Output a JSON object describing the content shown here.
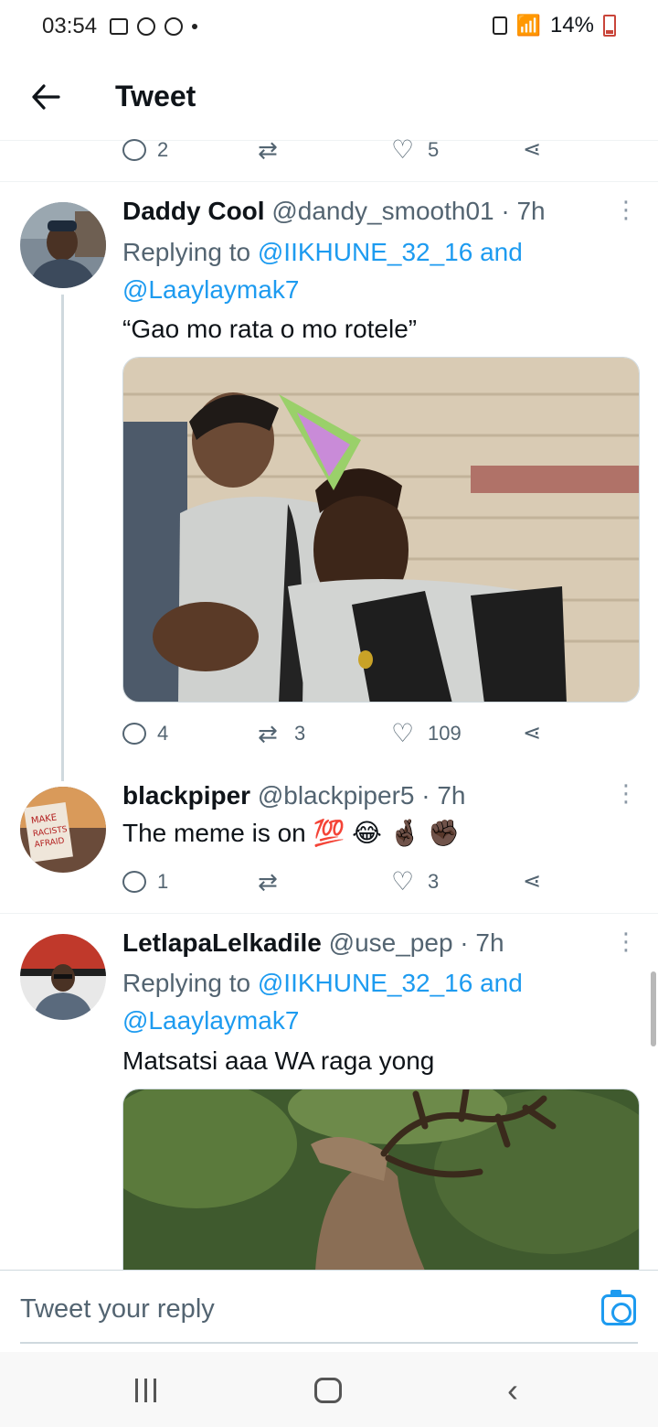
{
  "status_bar": {
    "time": "03:54",
    "battery": "14%"
  },
  "header": {
    "title": "Tweet"
  },
  "top_actions": {
    "replies": "2",
    "retweets": "",
    "likes": "5"
  },
  "tweets": [
    {
      "name": "Daddy Cool",
      "handle": "@dandy_smooth01",
      "sep": "·",
      "time": "7h",
      "replying_prefix": "Replying to",
      "replying_mention1": "@IIKHUNE_32_16",
      "replying_and": "and",
      "replying_mention2": "@Laaylaymak7",
      "text": "“Gao mo rata o mo rotele”",
      "replies": "4",
      "retweets": "3",
      "likes": "109"
    },
    {
      "name": "blackpiper",
      "handle": "@blackpiper5",
      "sep": "·",
      "time": "7h",
      "text": "The meme is on 💯 😂 🤞🏿 ✊🏿",
      "replies": "1",
      "retweets": "",
      "likes": "3"
    },
    {
      "name": "LetlapaLelkadile",
      "handle": "@use_pep",
      "sep": "·",
      "time": "7h",
      "replying_prefix": "Replying to",
      "replying_mention1": "@IIKHUNE_32_16",
      "replying_and": "and",
      "replying_mention2": "@Laaylaymak7",
      "text": "Matsatsi aaa WA raga yong"
    }
  ],
  "reply_bar": {
    "placeholder": "Tweet your reply"
  },
  "icons": {
    "back": "arrow-left-icon",
    "reply": "comment-icon",
    "retweet": "retweet-icon",
    "like": "heart-icon",
    "share": "share-icon",
    "more": "more-vertical-icon",
    "camera": "camera-icon"
  },
  "colors": {
    "accent": "#1d9bf0",
    "text": "#0f1419",
    "muted": "#536471"
  }
}
